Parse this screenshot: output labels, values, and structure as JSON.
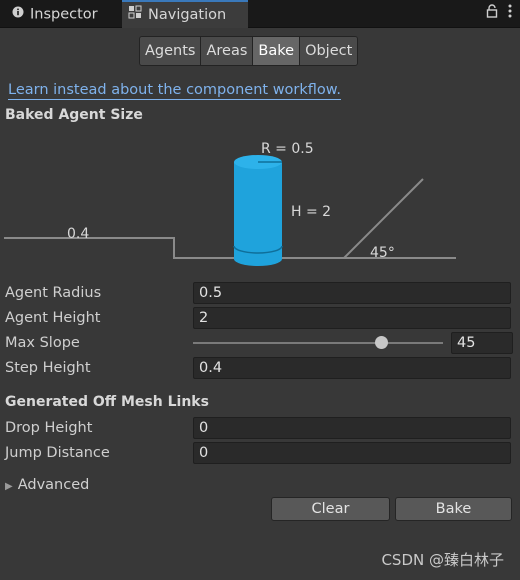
{
  "tabs": [
    {
      "label": "Inspector",
      "icon": "info-icon"
    },
    {
      "label": "Navigation",
      "icon": "navigation-icon"
    }
  ],
  "toolbar": [
    "Agents",
    "Areas",
    "Bake",
    "Object"
  ],
  "toolbar_selected": "Bake",
  "link_text": "Learn instead about the component workflow.",
  "baked_agent_size": {
    "heading": "Baked Agent Size",
    "radius_label": "R = 0.5",
    "height_label": "H = 2",
    "step_label": "0.4",
    "slope_label": "45°"
  },
  "fields": {
    "agent_radius": {
      "label": "Agent Radius",
      "value": "0.5"
    },
    "agent_height": {
      "label": "Agent Height",
      "value": "2"
    },
    "max_slope": {
      "label": "Max Slope",
      "value": "45",
      "slider_fraction": 0.75
    },
    "step_height": {
      "label": "Step Height",
      "value": "0.4"
    }
  },
  "off_mesh": {
    "heading": "Generated Off Mesh Links",
    "drop_height": {
      "label": "Drop Height",
      "value": "0"
    },
    "jump_distance": {
      "label": "Jump Distance",
      "value": "0"
    }
  },
  "advanced_label": "Advanced",
  "buttons": {
    "clear": "Clear",
    "bake": "Bake"
  },
  "watermark": "CSDN @臻白林子",
  "colors": {
    "accent": "#3a79bb",
    "agent_cylinder": "#1fa3dc",
    "link": "#7fb2ec"
  }
}
